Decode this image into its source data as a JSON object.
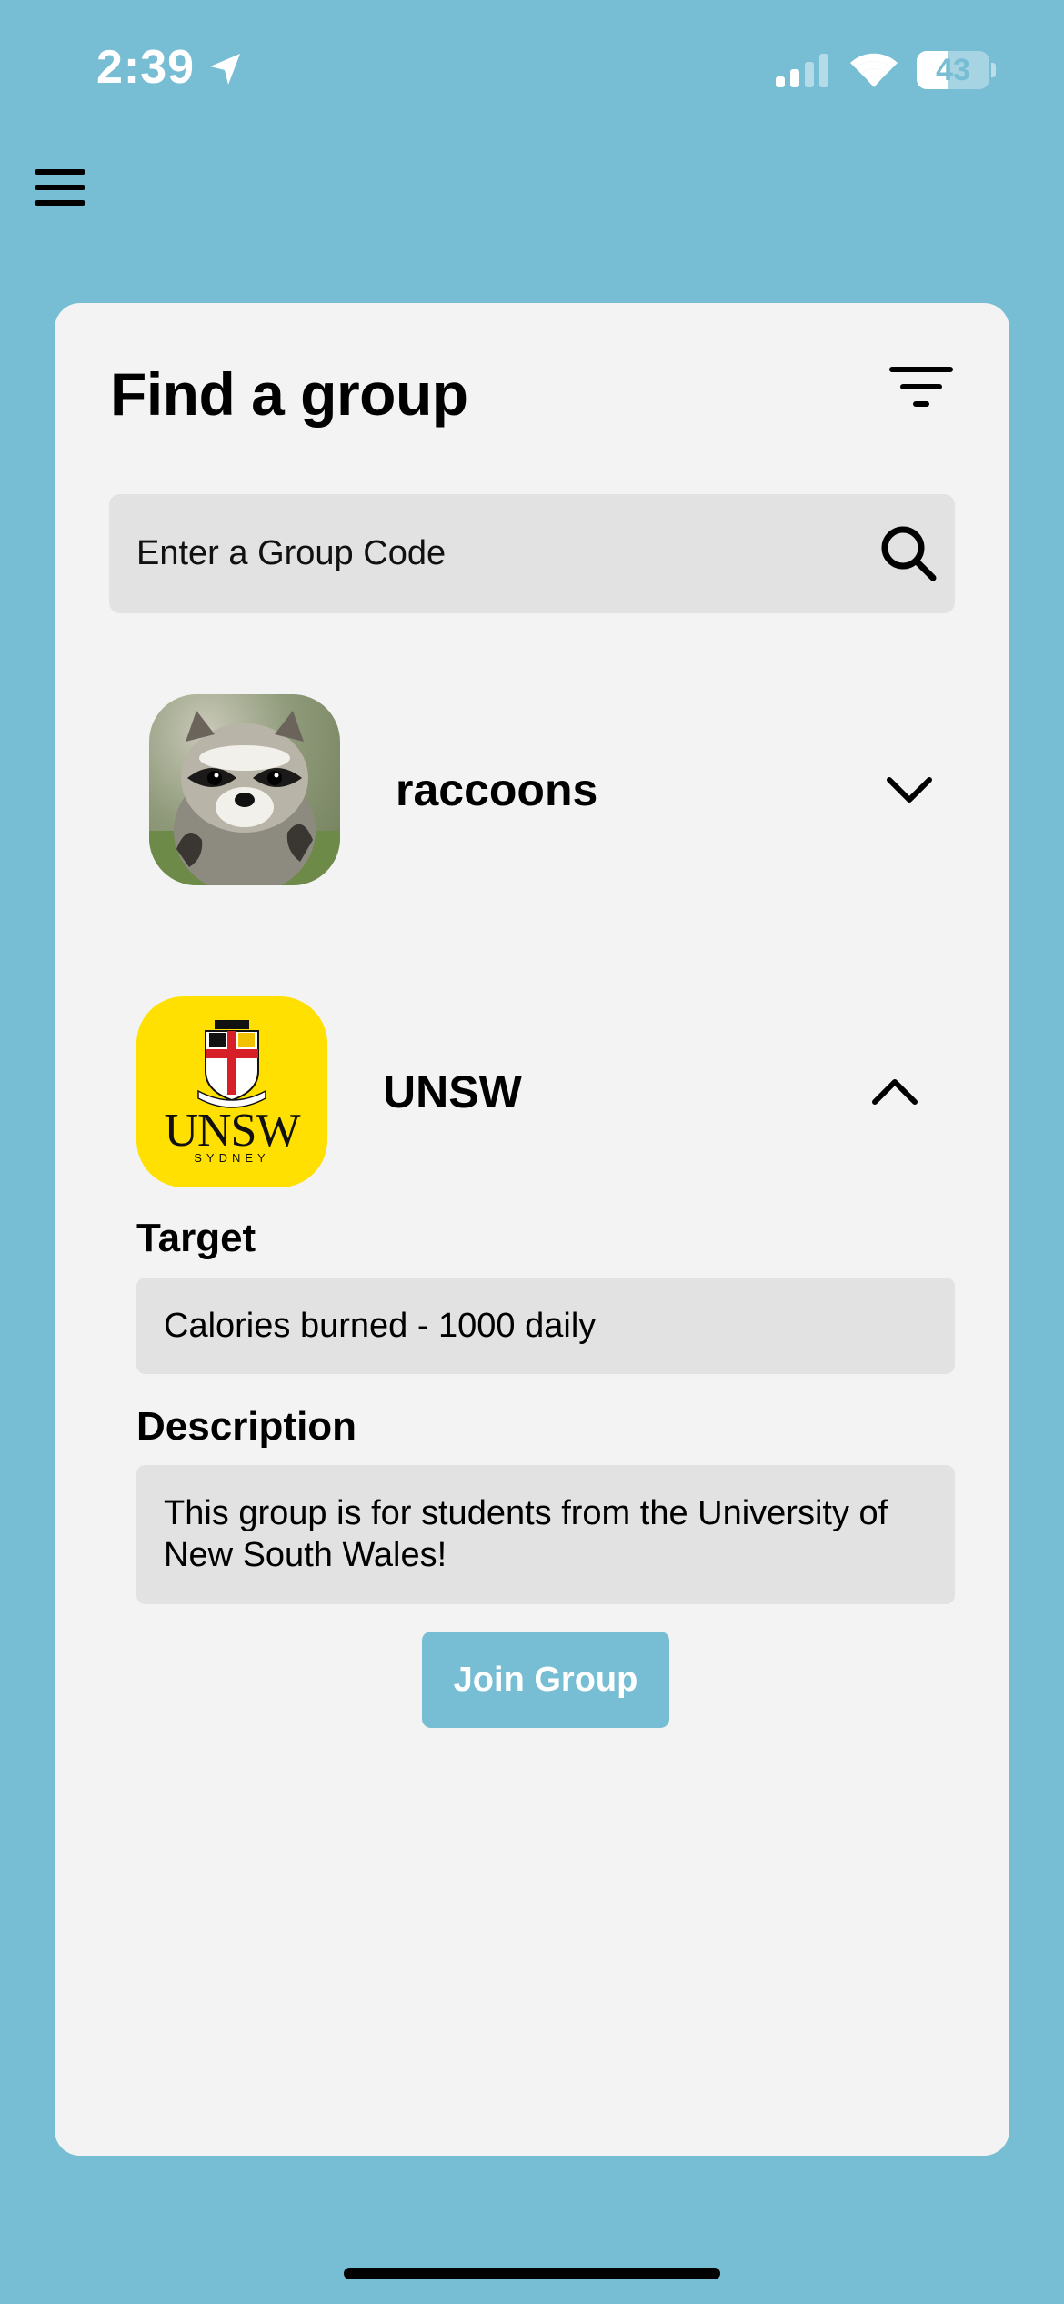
{
  "status_bar": {
    "time": "2:39",
    "battery_level": "43",
    "battery_fraction": 0.43,
    "signal_bars_active": 2
  },
  "header": {
    "menu_icon": "hamburger-menu-icon"
  },
  "page": {
    "title": "Find a group",
    "filter_icon": "filter-icon"
  },
  "search": {
    "placeholder": "Enter a Group Code",
    "value": "",
    "icon": "search-icon"
  },
  "groups": [
    {
      "name": "raccoons",
      "avatar": "raccoon-photo",
      "expanded": false,
      "chevron": "chevron-down-icon"
    },
    {
      "name": "UNSW",
      "avatar": "unsw-logo",
      "logo_text": "UNSW",
      "logo_subtext": "SYDNEY",
      "expanded": true,
      "chevron": "chevron-up-icon",
      "target_label": "Target",
      "target_value": "Calories burned - 1000 daily",
      "description_label": "Description",
      "description_value": "This group is for students from the University of New South Wales!",
      "join_label": "Join Group"
    }
  ],
  "colors": {
    "background": "#77BDD4",
    "card": "#F3F3F3",
    "field": "#E2E2E2",
    "accent": "#77BDD4",
    "unsw_yellow": "#FFE000"
  }
}
